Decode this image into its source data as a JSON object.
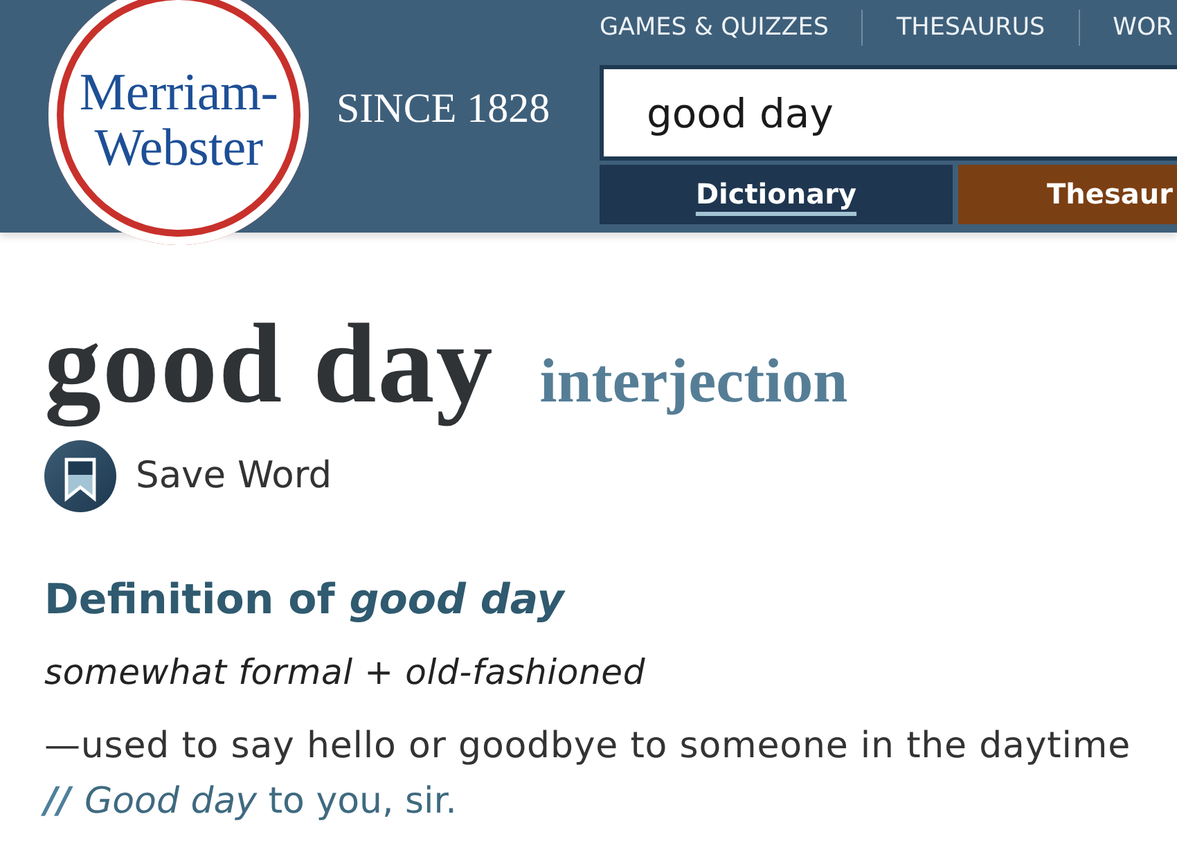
{
  "header": {
    "logo": {
      "wordmark": "Merriam-Webster"
    },
    "tagline": "SINCE 1828",
    "nav": [
      "GAMES & QUIZZES",
      "THESAURUS",
      "WOR"
    ]
  },
  "search": {
    "value": "good day",
    "tabs": [
      {
        "label": "Dictionary",
        "selected": true,
        "color": "#1f3650"
      },
      {
        "label": "Thesaur",
        "selected": false,
        "color": "#7b3f14"
      }
    ]
  },
  "entry": {
    "headword": "good day",
    "part_of_speech": "interjection",
    "save_button": {
      "label": "Save Word"
    },
    "definition": {
      "heading": "Definition of *good day*",
      "usage_label": "somewhat formal + old-fashioned",
      "text": "—used to say hello or goodbye to someone in the daytime",
      "example": {
        "marker": "//",
        "text": "*Good day* to you, sir."
      }
    }
  }
}
